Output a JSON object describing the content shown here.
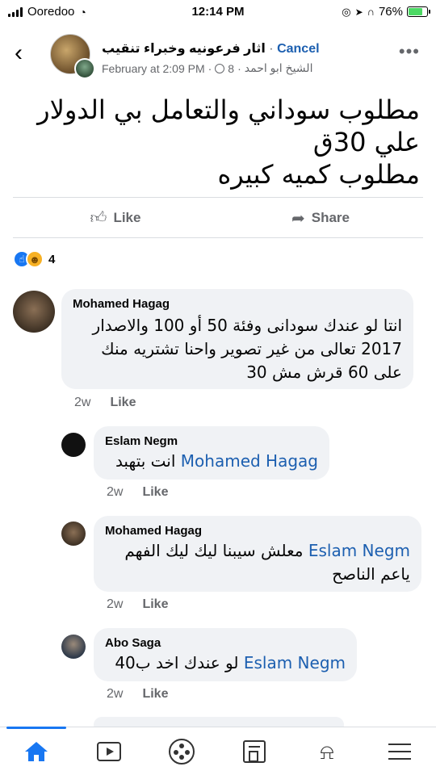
{
  "status_bar": {
    "carrier": "Ooredoo",
    "time": "12:14 PM",
    "battery": "76%",
    "battery_level": 0.76
  },
  "header": {
    "group_name": "اثار فرعونيه وخبراء تنقيب",
    "cancel_label": "Cancel",
    "author": "الشيخ ابو احمد",
    "member_count": "8",
    "date": "February at 2:09 PM"
  },
  "post": {
    "lines": [
      "مطلوب سوداني  والتعامل بي الدولار",
      "علي 30ق",
      "مطلوب كميه كبيره"
    ]
  },
  "actions": {
    "like": "Like",
    "share": "Share"
  },
  "reactions": {
    "count": "4"
  },
  "comments": [
    {
      "name": "Mohamed Hagag",
      "tag": "",
      "text": "انتا لو عندك سودانى وفئة 50 أو 100 والاصدار 2017 تعالى من غير تصوير واحنا تشتريه منك على 60 قرش مش 30",
      "age": "2w",
      "like": "Like"
    },
    {
      "name": "Eslam Negm",
      "tag": "Mohamed Hagag",
      "text": "انت بتهبد",
      "age": "2w",
      "like": "Like"
    },
    {
      "name": "Mohamed Hagag",
      "tag": "Eslam Negm",
      "text": "معلش سيبنا ليك  ليك الفهم ياعم الناصح",
      "age": "2w",
      "like": "Like"
    },
    {
      "name": "Abo Saga",
      "tag": "Eslam Negm",
      "text": "لو عندك اخد ب40",
      "age": "2w",
      "like": "Like"
    }
  ],
  "nav": {
    "items": [
      "home-icon",
      "video-icon",
      "groups-icon",
      "news-icon",
      "bell-icon",
      "menu-icon"
    ]
  }
}
